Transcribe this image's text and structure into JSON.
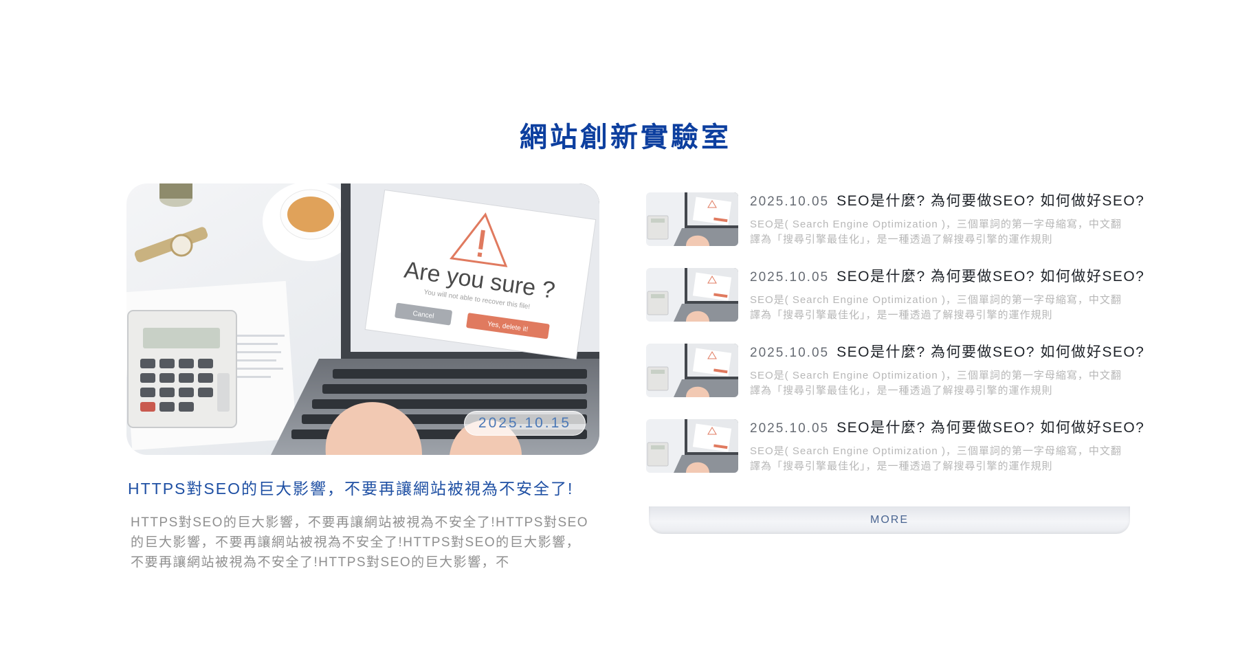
{
  "section": {
    "title": "網站創新實驗室"
  },
  "featured": {
    "date": "2025.10.15",
    "title": "HTTPS對SEO的巨大影響，不要再讓網站被視為不安全了!",
    "excerpt": "HTTPS對SEO的巨大影響，不要再讓網站被視為不安全了!HTTPS對SEO的巨大影響，不要再讓網站被視為不安全了!HTTPS對SEO的巨大影響，不要再讓網站被視為不安全了!HTTPS對SEO的巨大影響，不",
    "image": {
      "dialog_title": "Are you sure ?",
      "dialog_subtitle": "You will not able to recover this file!",
      "cancel_label": "Cancel",
      "confirm_label": "Yes, delete it!"
    }
  },
  "list": {
    "items": [
      {
        "date": "2025.10.05",
        "title": "SEO是什麼? 為何要做SEO? 如何做好SEO?",
        "desc": "SEO是( Search Engine Optimization )，三個單詞的第一字母縮寫，中文翻譯為「搜尋引擎最佳化」，是一種透過了解搜尋引擎的運作規則"
      },
      {
        "date": "2025.10.05",
        "title": "SEO是什麼? 為何要做SEO? 如何做好SEO?",
        "desc": "SEO是( Search Engine Optimization )，三個單詞的第一字母縮寫，中文翻譯為「搜尋引擎最佳化」，是一種透過了解搜尋引擎的運作規則"
      },
      {
        "date": "2025.10.05",
        "title": "SEO是什麼? 為何要做SEO? 如何做好SEO?",
        "desc": "SEO是( Search Engine Optimization )，三個單詞的第一字母縮寫，中文翻譯為「搜尋引擎最佳化」，是一種透過了解搜尋引擎的運作規則"
      },
      {
        "date": "2025.10.05",
        "title": "SEO是什麼? 為何要做SEO? 如何做好SEO?",
        "desc": "SEO是( Search Engine Optimization )，三個單詞的第一字母縮寫，中文翻譯為「搜尋引擎最佳化」，是一種透過了解搜尋引擎的運作規則"
      }
    ]
  },
  "more_label": "MORE",
  "colors": {
    "brand_blue": "#0d3f9f",
    "link_blue": "#1e4fa3",
    "dialog_orange": "#e07a5f"
  }
}
